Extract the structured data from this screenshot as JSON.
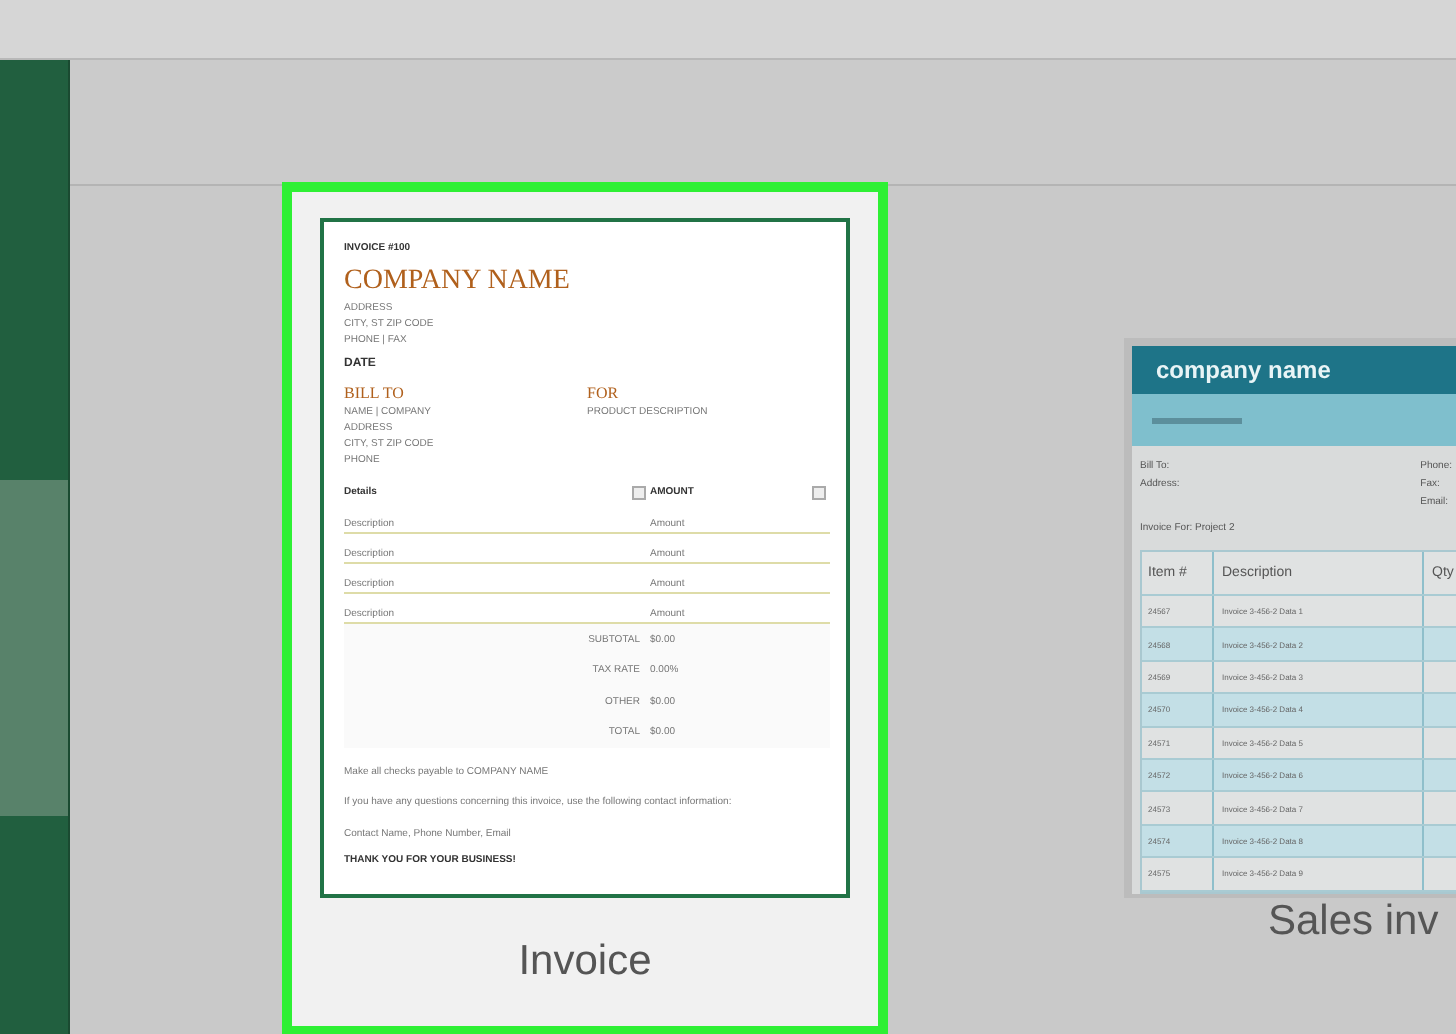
{
  "templates": [
    {
      "kind": "invoice",
      "label": "Invoice",
      "selected": true,
      "preview": {
        "number": "INVOICE #100",
        "company": "COMPANY NAME",
        "address_lines": [
          "ADDRESS",
          "CITY, ST ZIP CODE",
          "PHONE | FAX"
        ],
        "date": "DATE",
        "bill_to": {
          "title": "BILL TO",
          "lines": [
            "NAME | COMPANY",
            "ADDRESS",
            "CITY, ST ZIP CODE",
            "PHONE"
          ]
        },
        "for": {
          "title": "FOR",
          "lines": [
            "PRODUCT DESCRIPTION"
          ]
        },
        "columns": [
          "Details",
          "AMOUNT"
        ],
        "rows": [
          {
            "description": "Description",
            "amount": "Amount"
          },
          {
            "description": "Description",
            "amount": "Amount"
          },
          {
            "description": "Description",
            "amount": "Amount"
          },
          {
            "description": "Description",
            "amount": "Amount"
          }
        ],
        "totals": [
          {
            "label": "SUBTOTAL",
            "value": "$0.00"
          },
          {
            "label": "TAX RATE",
            "value": "0.00%"
          },
          {
            "label": "OTHER",
            "value": "$0.00"
          },
          {
            "label": "TOTAL",
            "value": "$0.00"
          }
        ],
        "notes": [
          "Make all checks payable to COMPANY NAME",
          "If you have any questions concerning this invoice, use the following contact information:",
          "Contact Name, Phone Number, Email"
        ],
        "thanks": "THANK YOU FOR YOUR BUSINESS!"
      }
    },
    {
      "kind": "sales",
      "label": "Sales inv",
      "selected": false,
      "preview": {
        "company": "company name",
        "bill_labels": [
          "Bill To:",
          "Address:"
        ],
        "contact_labels": [
          "Phone:",
          "Fax:",
          "Email:"
        ],
        "invoice_for": "Invoice For: Project 2",
        "columns": [
          "Item #",
          "Description",
          "Qty"
        ],
        "rows": [
          {
            "item": "24567",
            "description": "Invoice 3-456-2 Data 1"
          },
          {
            "item": "24568",
            "description": "Invoice 3-456-2 Data 2"
          },
          {
            "item": "24569",
            "description": "Invoice 3-456-2 Data 3"
          },
          {
            "item": "24570",
            "description": "Invoice 3-456-2 Data 4"
          },
          {
            "item": "24571",
            "description": "Invoice 3-456-2 Data 5"
          },
          {
            "item": "24572",
            "description": "Invoice 3-456-2 Data 6"
          },
          {
            "item": "24573",
            "description": "Invoice 3-456-2 Data 7"
          },
          {
            "item": "24574",
            "description": "Invoice 3-456-2 Data 8"
          },
          {
            "item": "24575",
            "description": "Invoice 3-456-2 Data 9"
          }
        ]
      }
    }
  ]
}
